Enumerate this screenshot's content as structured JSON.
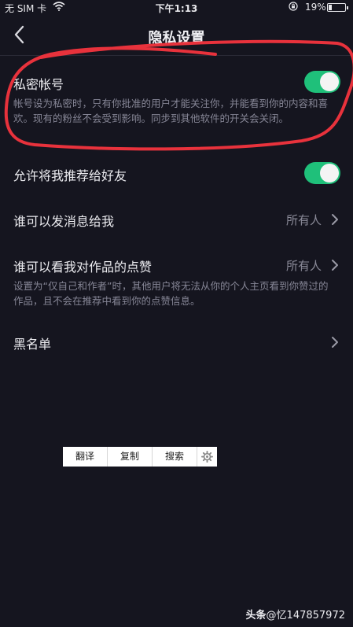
{
  "status_bar": {
    "carrier": "无 SIM 卡",
    "time": "下午1:13",
    "battery_pct": "19%"
  },
  "nav": {
    "title": "隐私设置",
    "back_icon": "chevron-left-icon"
  },
  "settings": {
    "private_account": {
      "label": "私密帐号",
      "description": "帐号设为私密时，只有你批准的用户才能关注你，并能看到你的内容和喜欢。现有的粉丝不会受到影响。同步到其他软件的开关会关闭。",
      "toggle_on": true
    },
    "recommend_to_friends": {
      "label": "允许将我推荐给好友",
      "toggle_on": true
    },
    "who_can_message": {
      "label": "谁可以发消息给我",
      "value": "所有人"
    },
    "who_can_see_likes": {
      "label": "谁可以看我对作品的点赞",
      "value": "所有人",
      "description": "设置为“仅自己和作者”时，其他用户将无法从你的个人主页看到你赞过的作品，且不会在推荐中看到你的点赞信息。"
    },
    "blacklist": {
      "label": "黑名单"
    }
  },
  "context_menu": {
    "items": [
      "翻译",
      "复制",
      "搜索"
    ],
    "settings_icon": "gear-icon"
  },
  "watermark": {
    "brand": "头条",
    "handle": "@忆147857972"
  },
  "colors": {
    "background": "#15151f",
    "toggle_on": "#1fc07a",
    "annotation_ring": "#e8323c"
  }
}
